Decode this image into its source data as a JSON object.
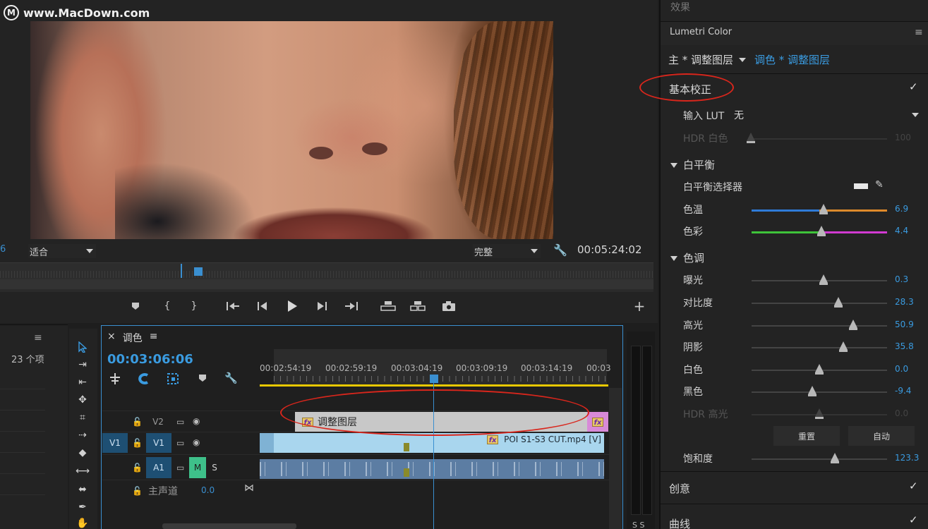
{
  "watermark": {
    "logo": "M",
    "text": "www.MacDown.com"
  },
  "monitor": {
    "frame_partial": "6",
    "fit_label": "适合",
    "quality_label": "完整",
    "timecode": "00:05:24:02"
  },
  "transport": {
    "marker": "marker-icon",
    "in": "{",
    "out": "}",
    "add": "+"
  },
  "project": {
    "count": "23 个项",
    "menu": "≡"
  },
  "timeline": {
    "close": "×",
    "tab": "调色",
    "menu": "≡",
    "timecode": "00:03:06:06",
    "ruler_labels": [
      "00:02:54:19",
      "00:02:59:19",
      "00:03:04:19",
      "00:03:09:19",
      "00:03:14:19",
      "00:03"
    ],
    "tracks": {
      "v2": "V2",
      "v1_src": "V1",
      "v1": "V1",
      "a1": "A1",
      "m": "M",
      "s": "S",
      "master": "主声道",
      "master_val": "0.0"
    },
    "adj_clip": "调整图层",
    "video_clip": "POI S1-S3 CUT.mp4 [V]",
    "fx": "fx",
    "meter_labels": "S S"
  },
  "right": {
    "effects_title": "效果",
    "lumetri_title": "Lumetri Color",
    "menu": "≡",
    "master_dd": "主 * 调整图层",
    "clip_dd": "调色 * 调整图层",
    "basic": {
      "title": "基本校正",
      "input_lut": "输入 LUT",
      "lut_value": "无",
      "hdr_white": "HDR 白色",
      "hdr_white_val": "100"
    },
    "wb": {
      "title": "白平衡",
      "selector": "白平衡选择器",
      "temp": "色温",
      "temp_val": "6.9",
      "tint": "色彩",
      "tint_val": "4.4"
    },
    "tone": {
      "title": "色调",
      "exposure": "曝光",
      "exposure_val": "0.3",
      "contrast": "对比度",
      "contrast_val": "28.3",
      "highlights": "高光",
      "highlights_val": "50.9",
      "shadows": "阴影",
      "shadows_val": "35.8",
      "whites": "白色",
      "whites_val": "0.0",
      "blacks": "黑色",
      "blacks_val": "-9.4",
      "hdr_spec": "HDR 高光",
      "hdr_spec_val": "0.0",
      "reset": "重置",
      "auto": "自动",
      "saturation": "饱和度",
      "saturation_val": "123.3"
    },
    "creative": "创意",
    "curves": "曲线",
    "check": "✓"
  },
  "colors": {
    "accent": "#3a9be0",
    "workarea": "#e8c800",
    "adjust_clip": "#c8c8c8",
    "video_clip": "#a9d6ee",
    "audio_clip": "#5c7da3",
    "annotation": "#d9261c"
  }
}
